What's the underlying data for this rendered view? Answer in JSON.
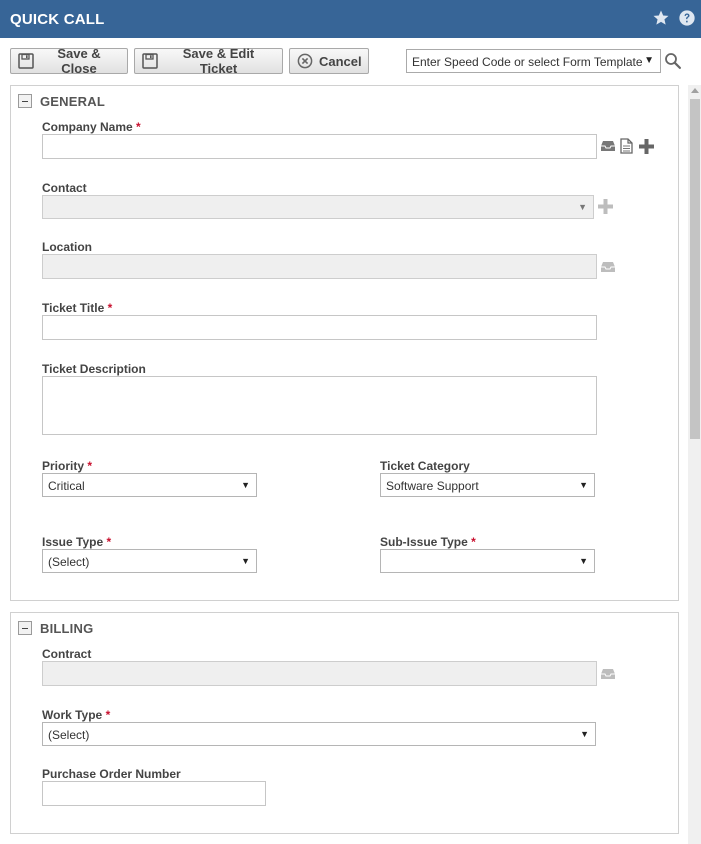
{
  "window": {
    "title": "QUICK CALL"
  },
  "toolbar": {
    "save_close_label": "Save & Close",
    "save_edit_label": "Save & Edit Ticket",
    "cancel_label": "Cancel",
    "speed_code_value": "Enter Speed Code or select Form Template"
  },
  "general": {
    "title": "GENERAL",
    "company_name_label": "Company Name",
    "contact_label": "Contact",
    "location_label": "Location",
    "ticket_title_label": "Ticket Title",
    "ticket_description_label": "Ticket Description",
    "priority_label": "Priority",
    "priority_value": "Critical",
    "ticket_category_label": "Ticket Category",
    "ticket_category_value": "Software Support",
    "issue_type_label": "Issue Type",
    "issue_type_value": "(Select)",
    "sub_issue_type_label": "Sub-Issue Type",
    "sub_issue_type_value": ""
  },
  "billing": {
    "title": "BILLING",
    "contract_label": "Contract",
    "work_type_label": "Work Type",
    "work_type_value": "(Select)",
    "po_number_label": "Purchase Order Number"
  },
  "required_marker": "*",
  "dropdown_arrow": "▼",
  "icons": {
    "title_star": "star-icon",
    "title_help": "help-icon",
    "save": "floppy-disk-icon",
    "cancel": "cancel-circle-icon",
    "search": "search-icon",
    "lookup": "lookup-tray-icon",
    "document": "document-icon",
    "add": "plus-icon"
  },
  "colors": {
    "titlebar": "#376597",
    "required": "#c8102e",
    "disabled_field": "#efefef"
  }
}
